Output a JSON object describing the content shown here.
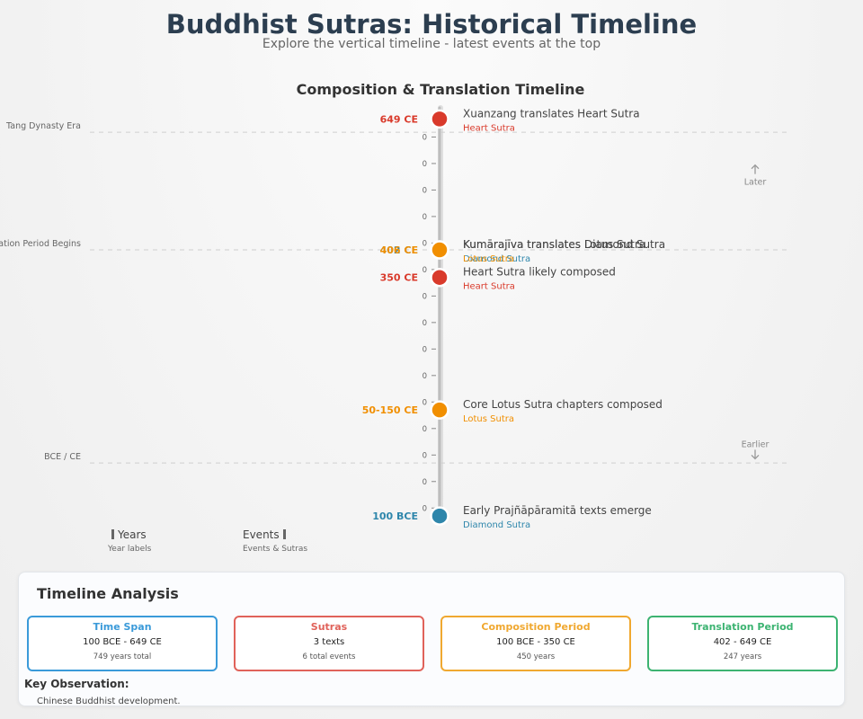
{
  "header": {
    "title": "Buddhist Sutras: Historical Timeline",
    "subtitle": "Explore the vertical timeline - latest events at the top"
  },
  "chart_data": {
    "type": "timeline",
    "title": "Composition & Translation Timeline",
    "ylim": [
      -110,
      670
    ],
    "tick_label": "0",
    "tick_values": [
      615,
      565,
      515,
      465,
      415,
      365,
      315,
      265,
      215,
      165,
      115,
      65,
      15,
      -35,
      -85
    ],
    "eras": [
      {
        "label": "Tang Dynasty Era",
        "year": 624
      },
      {
        "label": "Translation Period Begins",
        "year": 402
      },
      {
        "label": "BCE / CE",
        "year": 0
      }
    ],
    "directions": {
      "later": "Later",
      "earlier": "Earlier"
    },
    "events": [
      {
        "year_label": "649 CE",
        "year": 649,
        "title": "Xuanzang translates Heart Sutra",
        "sutra": "Heart Sutra",
        "color": "#d93a2b"
      },
      {
        "year_label": "402 CE",
        "year": 402,
        "title": "Kumārajīva translates Diamond Sutra",
        "sutra": "Diamond Sutra",
        "color": "#2e86ab"
      },
      {
        "year_label": "406 CE",
        "year": 402,
        "title": "Kumārajīva translates Lotus Sutra",
        "sutra": "Lotus Sutra",
        "color": "#f18f01"
      },
      {
        "year_label": "350 CE",
        "year": 350,
        "title": "Heart Sutra likely composed",
        "sutra": "Heart Sutra",
        "color": "#d93a2b"
      },
      {
        "year_label": "50-150 CE",
        "year": 100,
        "title": "Core Lotus Sutra chapters composed",
        "sutra": "Lotus Sutra",
        "color": "#f18f01"
      },
      {
        "year_label": "100 BCE",
        "year": -100,
        "title": "Early Prajñāpāramitā texts emerge",
        "sutra": "Diamond Sutra",
        "color": "#2e86ab"
      }
    ]
  },
  "legend": {
    "years_label": "Years",
    "years_sub": "Year labels",
    "events_label": "Events",
    "events_sub": "Events & Sutras"
  },
  "analysis": {
    "title": "Timeline Analysis",
    "cards": [
      {
        "title": "Time Span",
        "value": "100 BCE - 649 CE",
        "sub": "749 years total",
        "color": "#3a9ad9"
      },
      {
        "title": "Sutras",
        "value": "3 texts",
        "sub": "6 total events",
        "color": "#e0625a"
      },
      {
        "title": "Composition Period",
        "value": "100 BCE - 350 CE",
        "sub": "450 years",
        "color": "#f0a830"
      },
      {
        "title": "Translation Period",
        "value": "402 - 649 CE",
        "sub": "247 years",
        "color": "#3cb371"
      }
    ],
    "observation_title": "Key Observation:",
    "observation_text": "Chinese Buddhist development."
  }
}
